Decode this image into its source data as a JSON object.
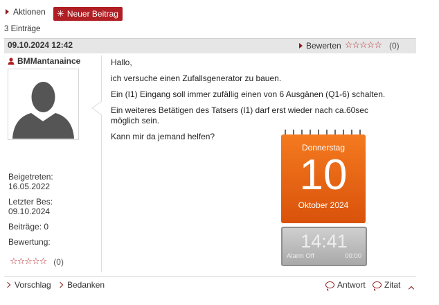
{
  "toolbar": {
    "actions_label": "Aktionen",
    "new_post_label": "Neuer Beitrag"
  },
  "count_label": "3 Einträge",
  "post": {
    "date": "09.10.2024 12:42",
    "rate_label": "Bewerten",
    "rate_count": "(0)",
    "author": {
      "name": "BMMantanaince",
      "joined_label": "Beigetreten:",
      "joined": "16.05.2022",
      "last_visit_label": "Letzter Bes:",
      "last_visit": "09.10.2024",
      "posts_label": "Beiträge: 0",
      "rating_label": "Bewertung:",
      "rating_count": "(0)"
    },
    "body": {
      "line1": "Hallo,",
      "line2": "ich versuche einen Zufallsgenerator zu bauen.",
      "line3": "Ein (I1) Eingang soll immer zufällig einen von 6 Ausgänen (Q1-6) schalten.",
      "line4a": "Ein weiteres Betätigen des Tatsers (I1) darf erst wieder nach ca.60sec",
      "line4b": "möglich sein.",
      "line5": "Kann mir da jemand helfen?"
    },
    "calendar": {
      "weekday": "Donnerstag",
      "day": "10",
      "month_year": "Oktober 2024"
    },
    "clock": {
      "time": "14:41",
      "alarm": "Alarm Off",
      "alarm_time": "00:00"
    }
  },
  "footer": {
    "suggest_label": "Vorschlag",
    "thanks_label": "Bedanken",
    "reply_label": "Antwort",
    "quote_label": "Zitat"
  },
  "colors": {
    "accent": "#b01f24",
    "calendar": "#e8600f",
    "header_bg": "#e6e6e6"
  }
}
